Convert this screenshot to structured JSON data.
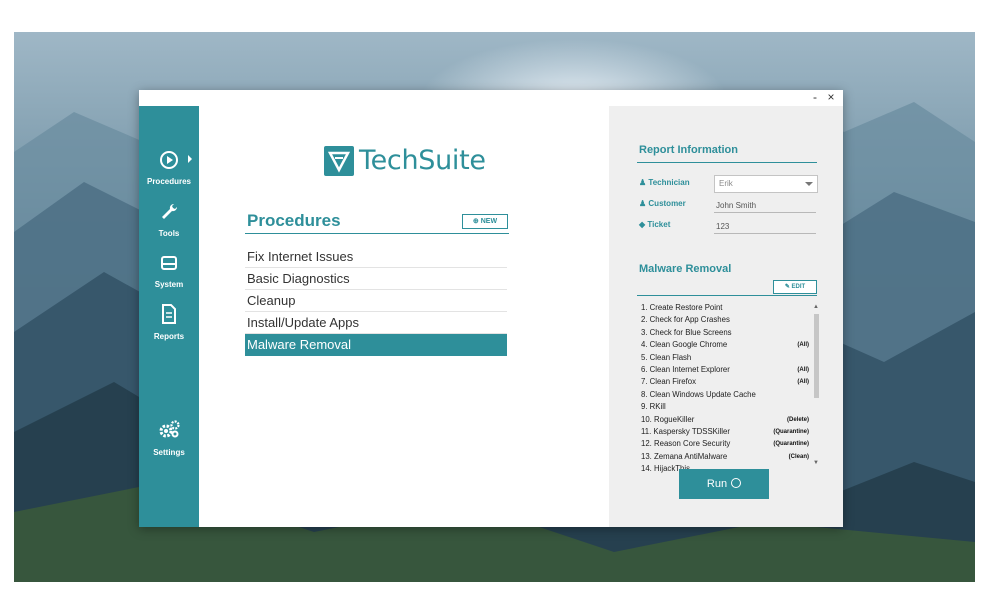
{
  "window": {
    "minimize_label": "-",
    "close_label": "×"
  },
  "brand": {
    "name": "TechSuite",
    "color": "#2e8f9a"
  },
  "sidebar": {
    "items": [
      {
        "label": "Procedures",
        "icon": "play-icon"
      },
      {
        "label": "Tools",
        "icon": "wrench-icon"
      },
      {
        "label": "System",
        "icon": "hard-drive-icon"
      },
      {
        "label": "Reports",
        "icon": "document-icon"
      },
      {
        "label": "Settings",
        "icon": "gears-icon"
      }
    ]
  },
  "procedures": {
    "title": "Procedures",
    "new_label": "NEW",
    "items": [
      {
        "label": "Fix Internet Issues"
      },
      {
        "label": "Basic Diagnostics"
      },
      {
        "label": "Cleanup"
      },
      {
        "label": "Install/Update Apps"
      },
      {
        "label": "Malware Removal"
      }
    ],
    "selected": "Malware Removal"
  },
  "report": {
    "title": "Report Information",
    "technician": {
      "label": "Technician",
      "value": "Erik"
    },
    "customer": {
      "label": "Customer",
      "value": "John Smith"
    },
    "ticket": {
      "label": "Ticket",
      "value": "123"
    }
  },
  "malware": {
    "title": "Malware Removal",
    "edit_label": "EDIT",
    "steps": [
      {
        "text": "1. Create Restore Point",
        "note": ""
      },
      {
        "text": "2. Check for App Crashes",
        "note": ""
      },
      {
        "text": "3. Check for Blue Screens",
        "note": ""
      },
      {
        "text": "4. Clean Google Chrome",
        "note": "(All)"
      },
      {
        "text": "5. Clean Flash",
        "note": ""
      },
      {
        "text": "6. Clean Internet Explorer",
        "note": "(All)"
      },
      {
        "text": "7. Clean Firefox",
        "note": "(All)"
      },
      {
        "text": "8. Clean Windows Update Cache",
        "note": ""
      },
      {
        "text": "9. RKill",
        "note": ""
      },
      {
        "text": "10. RogueKiller",
        "note": "(Delete)"
      },
      {
        "text": "11. Kaspersky TDSSKiller",
        "note": "(Quarantine)"
      },
      {
        "text": "12. Reason Core Security",
        "note": "(Quarantine)"
      },
      {
        "text": "13. Zemana AntiMalware",
        "note": "(Clean)"
      },
      {
        "text": "14. HijackThis",
        "note": ""
      }
    ],
    "run_label": "Run"
  }
}
